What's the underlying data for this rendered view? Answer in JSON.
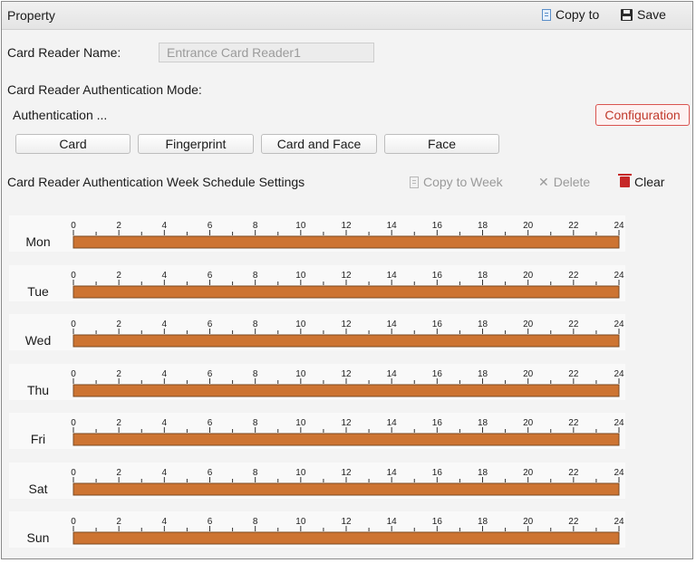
{
  "header": {
    "title": "Property",
    "copy_to_label": "Copy to",
    "save_label": "Save"
  },
  "reader": {
    "name_label": "Card Reader Name:",
    "name_value": "Entrance Card Reader1",
    "auth_mode_label": "Card Reader Authentication Mode:",
    "authentication_label": "Authentication ...",
    "configuration_label": "Configuration",
    "modes": [
      "Card",
      "Fingerprint",
      "Card and Face",
      "Face"
    ]
  },
  "schedule": {
    "title": "Card Reader Authentication Week Schedule Settings",
    "copy_to_week_label": "Copy to Week",
    "delete_label": "Delete",
    "clear_label": "Clear",
    "hour_ticks": [
      "0",
      "2",
      "4",
      "6",
      "8",
      "10",
      "12",
      "14",
      "16",
      "18",
      "20",
      "22",
      "24"
    ],
    "days": [
      {
        "label": "Mon",
        "segments": [
          {
            "start": 0,
            "end": 24
          }
        ]
      },
      {
        "label": "Tue",
        "segments": [
          {
            "start": 0,
            "end": 24
          }
        ]
      },
      {
        "label": "Wed",
        "segments": [
          {
            "start": 0,
            "end": 24
          }
        ]
      },
      {
        "label": "Thu",
        "segments": [
          {
            "start": 0,
            "end": 24
          }
        ]
      },
      {
        "label": "Fri",
        "segments": [
          {
            "start": 0,
            "end": 24
          }
        ]
      },
      {
        "label": "Sat",
        "segments": [
          {
            "start": 0,
            "end": 24
          }
        ]
      },
      {
        "label": "Sun",
        "segments": [
          {
            "start": 0,
            "end": 24
          }
        ]
      }
    ]
  },
  "colors": {
    "segment_fill": "#cd7432",
    "segment_border": "#7a4a22",
    "tick": "#333333"
  }
}
